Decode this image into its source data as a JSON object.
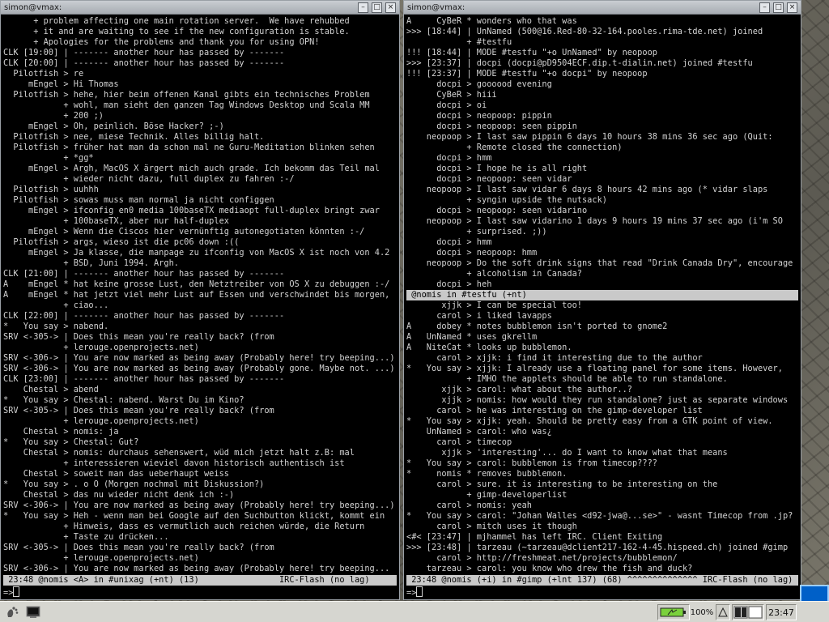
{
  "colors": {
    "accent": "#0060c8",
    "terminal_bg": "#000000",
    "terminal_fg": "#d2d2d2",
    "statusbar": "#c9c9c9"
  },
  "left_window": {
    "title": "simon@vmax:",
    "lines": [
      "      + problem affecting one main rotation server.  We have rehubbed",
      "      + it and are waiting to see if the new configuration is stable.",
      "      + Apologies for the problems and thank you for using OPN!",
      "CLK [19:00] | ------- another hour has passed by -------",
      "CLK [20:00] | ------- another hour has passed by -------",
      "  Pilotfish > re",
      "     mEngel > Hi Thomas",
      "  Pilotfish > hehe, hier beim offenen Kanal gibts ein technisches Problem",
      "            + wohl, man sieht den ganzen Tag Windows Desktop und Scala MM",
      "            + 200 ;)",
      "     mEngel > Oh, peinlich. Böse Hacker? ;-)",
      "  Pilotfish > nee, miese Technik. Alles billig halt.",
      "  Pilotfish > früher hat man da schon mal ne Guru-Meditation blinken sehen",
      "            + *gg*",
      "     mEngel > Argh, MacOS X ärgert mich auch grade. Ich bekomm das Teil mal",
      "            + wieder nicht dazu, full duplex zu fahren :-/",
      "  Pilotfish > uuhhh",
      "  Pilotfish > sowas muss man normal ja nicht configgen",
      "     mEngel > ifconfig en0 media 100baseTX mediaopt full-duplex bringt zwar",
      "            + 100baseTX, aber nur half-duplex",
      "     mEngel > Wenn die Ciscos hier vernünftig autonegotiaten könnten :-/",
      "  Pilotfish > args, wieso ist die pc06 down :((",
      "     mEngel > Ja klasse, die manpage zu ifconfig von MacOS X ist noch von 4.2",
      "            + BSD, Juni 1994. Argh.",
      "CLK [21:00] | ------- another hour has passed by -------",
      "A    mEngel * hat keine grosse Lust, den Netztreiber von OS X zu debuggen :-/",
      "A    mEngel * hat jetzt viel mehr Lust auf Essen und verschwindet bis morgen,",
      "            + ciao...",
      "CLK [22:00] | ------- another hour has passed by -------",
      "*   You say > nabend.",
      "SRV <-305-> | Does this mean you're really back? (from",
      "            + lerouge.openprojects.net)",
      "SRV <-306-> | You are now marked as being away (Probably here! try beeping...)",
      "SRV <-306-> | You are now marked as being away (Probably gone. Maybe not. ...)",
      "CLK [23:00] | ------- another hour has passed by -------",
      "    Chestal > abend",
      "*   You say > Chestal: nabend. Warst Du im Kino?",
      "SRV <-305-> | Does this mean you're really back? (from",
      "            + lerouge.openprojects.net)",
      "    Chestal > nomis: ja",
      "*   You say > Chestal: Gut?",
      "    Chestal > nomis: durchaus sehenswert, wüd mich jetzt halt z.B: mal",
      "            + interessieren wieviel davon historisch authentisch ist",
      "    Chestal > soweit man das ueberhaupt weiss",
      "*   You say > . o O (Morgen nochmal mit Diskussion?)",
      "    Chestal > das nu wieder nicht denk ich :-)",
      "SRV <-306-> | You are now marked as being away (Probably here! try beeping...)",
      "*   You say > Heh - wenn man bei Google auf den Suchbutton klickt, kommt ein",
      "            + Hinweis, dass es vermutlich auch reichen würde, die Return",
      "            + Taste zu drücken...",
      "SRV <-305-> | Does this mean you're really back? (from",
      "            + lerouge.openprojects.net)",
      "SRV <-306-> | You are now marked as being away (Probably here! try beeping..."
    ],
    "status": " 23:48 @nomis <A> in #unixag (+nt) (13)                IRC-Flash (no lag)",
    "prompt": "=>"
  },
  "right_window": {
    "title": "simon@vmax:",
    "lines": [
      "A     CyBeR * wonders who that was",
      ">>> [18:44] | UnNamed (500@16.Red-80-32-164.pooles.rima-tde.net) joined",
      "            + #testfu",
      "!!! [18:44] | MODE #testfu \"+o UnNamed\" by neopoop",
      ">>> [23:37] | docpi (docpi@pD9504ECF.dip.t-dialin.net) joined #testfu",
      "!!! [23:37] | MODE #testfu \"+o docpi\" by neopoop",
      "      docpi > goooood evening",
      "      CyBeR > hiii",
      "      docpi > oi",
      "      docpi > neopoop: pippin",
      "      docpi > neopoop: seen pippin",
      "    neopoop > I last saw pippin 6 days 10 hours 38 mins 36 sec ago (Quit:",
      "            + Remote closed the connection)",
      "      docpi > hmm",
      "      docpi > I hope he is all right",
      "      docpi > neopoop: seen vidar",
      "    neopoop > I last saw vidar 6 days 8 hours 42 mins ago (* vidar slaps",
      "            + syngin upside the nutsack)",
      "      docpi > neopoop: seen vidarino",
      "    neopoop > I last saw vidarino 1 days 9 hours 19 mins 37 sec ago (i'm SO",
      "            + surprised. ;))",
      "      docpi > hmm",
      "      docpi > neopoop: hmm",
      "    neopoop > Do the soft drink signs that read \"Drink Canada Dry\", encourage",
      "            + alcoholism in Canada?",
      "      docpi > heh",
      " @nomis in #testfu (+nt)",
      "       xjjk > I can be special too!",
      "      carol > i liked lavapps",
      "A     dobey * notes bubblemon isn't ported to gnome2",
      "A   UnNamed * uses gkrellm",
      "A   NiteCat * looks up bubblemon.",
      "      carol > xjjk: i find it interesting due to the author",
      "*   You say > xjjk: I already use a floating panel for some items. However,",
      "            + IMHO the applets should be able to run standalone.",
      "       xjjk > carol: what about the author..?",
      "       xjjk > nomis: how would they run standalone? just as separate windows",
      "      carol > he was interesting on the gimp-developer list",
      "*   You say > xjjk: yeah. Should be pretty easy from a GTK point of view.",
      "    UnNamed > carol: who was¿",
      "      carol > timecop",
      "       xjjk > 'interesting'... do I want to know what that means",
      "*   You say > carol: bubblemon is from timecop????",
      "*     nomis * removes bubblemon.",
      "      carol > sure. it is interesting to be interesting on the",
      "            + gimp-developerlist",
      "      carol > nomis: yeah",
      "*   You say > carol: \"Johan Walles <d92-jwa@...se>\" - wasnt Timecop from .jp?",
      "      carol > mitch uses it though",
      "<#< [23:47] | mjhammel has left IRC. Client Exiting",
      ">>> [23:48] | tarzeau (~tarzeau@dclient217-162-4-45.hispeed.ch) joined #gimp",
      "      carol > http://freshmeat.net/projects/bubblemon/",
      "    tarzeau > carol: you know who drew the fish and duck?"
    ],
    "status": " 23:48 @nomis (+i) in #gimp (+lnt 137) (68) ^^^^^^^^^^^^^^ IRC-Flash (no lag)",
    "prompt": "=>"
  },
  "panel": {
    "zoom_label": "100%",
    "clock": "23:47",
    "icons": [
      "foot-menu-icon",
      "terminal-launcher-icon",
      "battery-icon",
      "triangle-icon",
      "workspace-pager-icon"
    ]
  }
}
